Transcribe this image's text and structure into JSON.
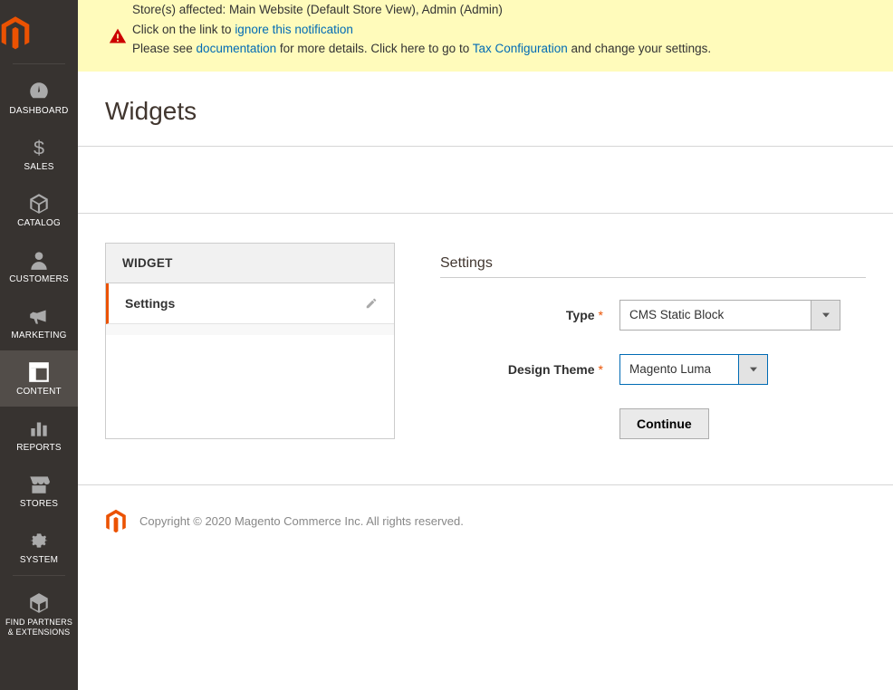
{
  "sidebar": {
    "items": [
      {
        "label": "DASHBOARD"
      },
      {
        "label": "SALES"
      },
      {
        "label": "CATALOG"
      },
      {
        "label": "CUSTOMERS"
      },
      {
        "label": "MARKETING"
      },
      {
        "label": "CONTENT"
      },
      {
        "label": "REPORTS"
      },
      {
        "label": "STORES"
      },
      {
        "label": "SYSTEM"
      },
      {
        "label": "FIND PARTNERS & EXTENSIONS"
      }
    ]
  },
  "notice": {
    "line1": "Store(s) affected: Main Website (Default Store View), Admin (Admin)",
    "line2a": "Click on the link to ",
    "line2link": "ignore this notification",
    "line3a": "Please see ",
    "line3link1": "documentation",
    "line3b": " for more details. Click here to go to ",
    "line3link2": "Tax Configuration",
    "line3c": " and change your settings."
  },
  "page": {
    "title": "Widgets"
  },
  "panel": {
    "header": "WIDGET",
    "item": "Settings"
  },
  "settings": {
    "title": "Settings",
    "type_label": "Type",
    "type_value": "CMS Static Block",
    "theme_label": "Design Theme",
    "theme_value": "Magento Luma",
    "continue": "Continue"
  },
  "footer": {
    "text": "Copyright © 2020 Magento Commerce Inc. All rights reserved."
  }
}
